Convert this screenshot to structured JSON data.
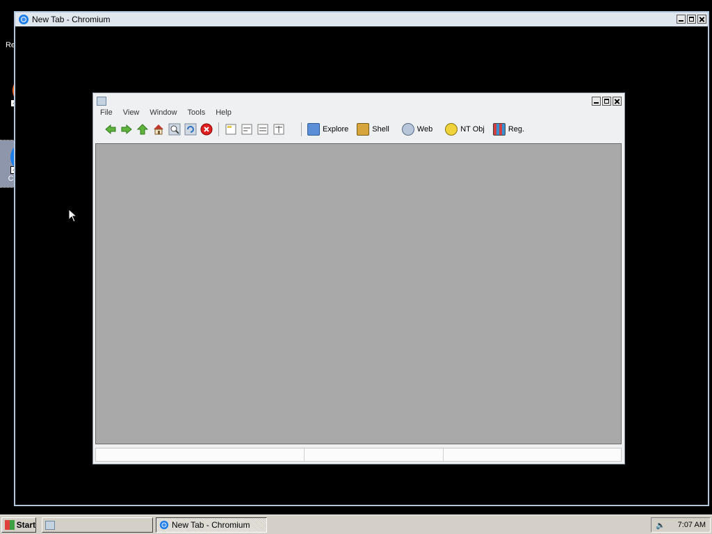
{
  "desktop": {
    "icons": [
      {
        "label": "Recycle Bin",
        "icon": "recycle-bin-icon"
      },
      {
        "label": "Firefox",
        "icon": "firefox-icon"
      },
      {
        "label": "Chromium",
        "icon": "chromium-icon"
      }
    ]
  },
  "chromium_window": {
    "title": "New Tab - Chromium"
  },
  "app_window": {
    "menu": [
      "File",
      "View",
      "Window",
      "Tools",
      "Help"
    ],
    "toolbar_icons": [
      "back-icon",
      "forward-icon",
      "up-icon",
      "home-icon",
      "search-icon",
      "refresh-icon",
      "stop-icon",
      "view-1-icon",
      "view-2-icon",
      "view-3-icon",
      "view-4-icon"
    ],
    "toolbar_buttons": [
      "Explore",
      "Shell",
      "Web",
      "NT Obj",
      "Reg."
    ]
  },
  "taskbar": {
    "start_label": "Start",
    "tasks": [
      {
        "label": ""
      },
      {
        "label": "New Tab - Chromium"
      }
    ],
    "clock": "7:07 AM"
  }
}
